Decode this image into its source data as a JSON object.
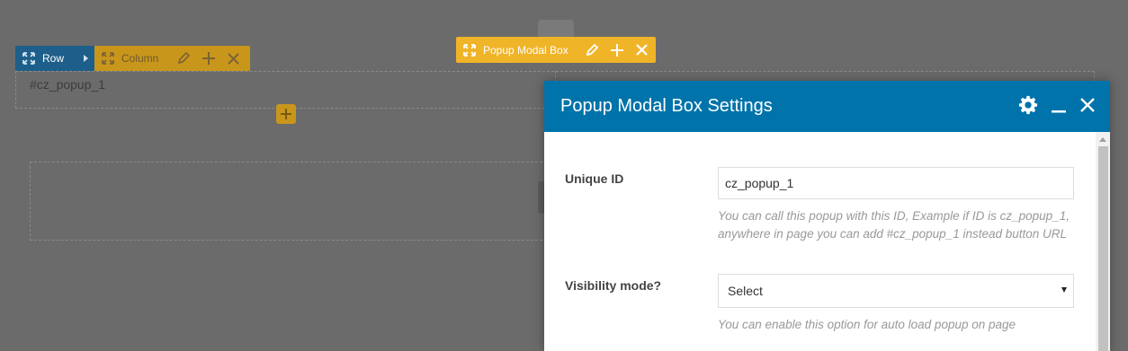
{
  "background": {
    "anchor_text": "#cz_popup_1"
  },
  "row_toolbar": {
    "label": "Row"
  },
  "column_toolbar": {
    "label": "Column"
  },
  "element_toolbar": {
    "label": "Popup Modal Box"
  },
  "modal": {
    "title": "Popup Modal Box Settings",
    "fields": {
      "unique_id": {
        "label": "Unique ID",
        "value": "cz_popup_1",
        "help_line1": "You can call this popup with this ID, Example if ID is cz_popup_1,",
        "help_line2": "anywhere in page you can add #cz_popup_1 instead button URL"
      },
      "visibility": {
        "label": "Visibility mode?",
        "selected": "Select",
        "help": "You can enable this option for auto load popup on page"
      }
    }
  },
  "colors": {
    "header_blue": "#0073aa",
    "row_blue": "#1d5f8a",
    "column_gold": "#c9961c",
    "popup_gold": "#f0b429",
    "overlay_gray": "#6b6b6b"
  },
  "icons": {
    "move": "move-arrows-icon",
    "edit": "pencil-icon",
    "add": "plus-icon",
    "remove": "close-icon",
    "settings": "gear-icon",
    "minimize": "minimize-icon"
  }
}
